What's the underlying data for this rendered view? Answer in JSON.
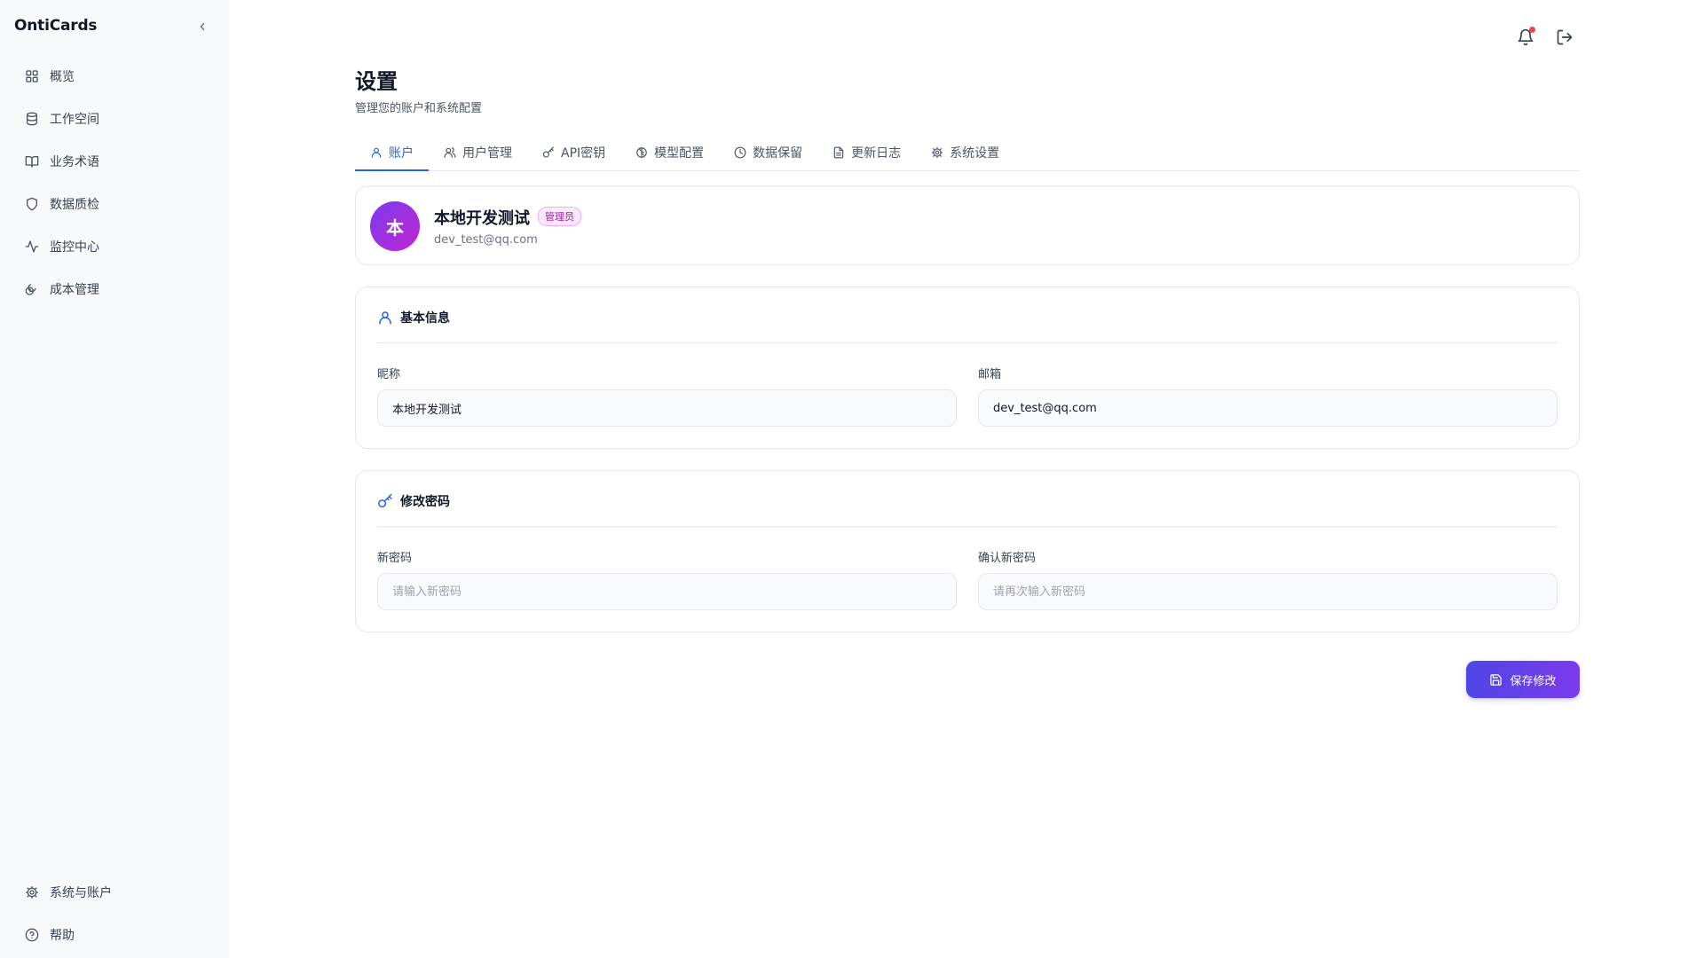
{
  "app": {
    "name": "OntiCards"
  },
  "sidebar": {
    "items": [
      {
        "label": "概览",
        "icon": "grid-icon"
      },
      {
        "label": "工作空间",
        "icon": "database-icon"
      },
      {
        "label": "业务术语",
        "icon": "book-icon"
      },
      {
        "label": "数据质检",
        "icon": "shield-icon"
      },
      {
        "label": "监控中心",
        "icon": "activity-icon"
      },
      {
        "label": "成本管理",
        "icon": "coins-icon"
      }
    ],
    "bottom_items": [
      {
        "label": "系统与账户",
        "icon": "gear-icon"
      },
      {
        "label": "帮助",
        "icon": "help-circle-icon"
      }
    ]
  },
  "header": {
    "notification_dot_color": "#ef4444"
  },
  "page": {
    "title": "设置",
    "subtitle": "管理您的账户和系统配置"
  },
  "tabs": [
    {
      "label": "账户",
      "icon": "user-icon",
      "active": true
    },
    {
      "label": "用户管理",
      "icon": "users-icon",
      "active": false
    },
    {
      "label": "API密钥",
      "icon": "key-icon",
      "active": false
    },
    {
      "label": "模型配置",
      "icon": "brain-icon",
      "active": false
    },
    {
      "label": "数据保留",
      "icon": "clock-icon",
      "active": false
    },
    {
      "label": "更新日志",
      "icon": "file-text-icon",
      "active": false
    },
    {
      "label": "系统设置",
      "icon": "gear-icon",
      "active": false
    }
  ],
  "profile": {
    "avatar_char": "本",
    "name": "本地开发测试",
    "role": "管理员",
    "email": "dev_test@qq.com"
  },
  "basic_info": {
    "title": "基本信息",
    "nickname_label": "昵称",
    "nickname_value": "本地开发测试",
    "email_label": "邮箱",
    "email_value": "dev_test@qq.com"
  },
  "password": {
    "title": "修改密码",
    "new_label": "新密码",
    "new_placeholder": "请输入新密码",
    "confirm_label": "确认新密码",
    "confirm_placeholder": "请再次输入新密码"
  },
  "actions": {
    "save_label": "保存修改"
  },
  "colors": {
    "accent": "#2563eb",
    "button_gradient_start": "#4f46e5",
    "button_gradient_end": "#7c3aed",
    "avatar_gradient_start": "#7c3aed",
    "avatar_gradient_end": "#c026d3"
  }
}
